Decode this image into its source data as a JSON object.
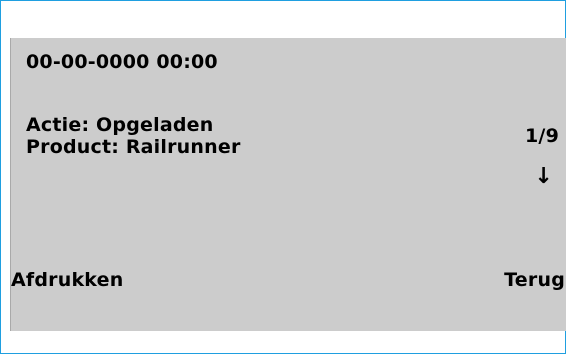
{
  "screen": {
    "datetime": "00-00-0000 00:00",
    "action_line": "Actie: Opgeladen",
    "product_line": "Product: Railrunner",
    "page_indicator": "1/9",
    "scroll_arrow": "↓"
  },
  "softkeys": {
    "left_label": "Afdrukken",
    "right_label": "Terug"
  },
  "colors": {
    "frame_border": "#1f9fe0",
    "lcd_background": "#cccccc",
    "text": "#000000"
  }
}
